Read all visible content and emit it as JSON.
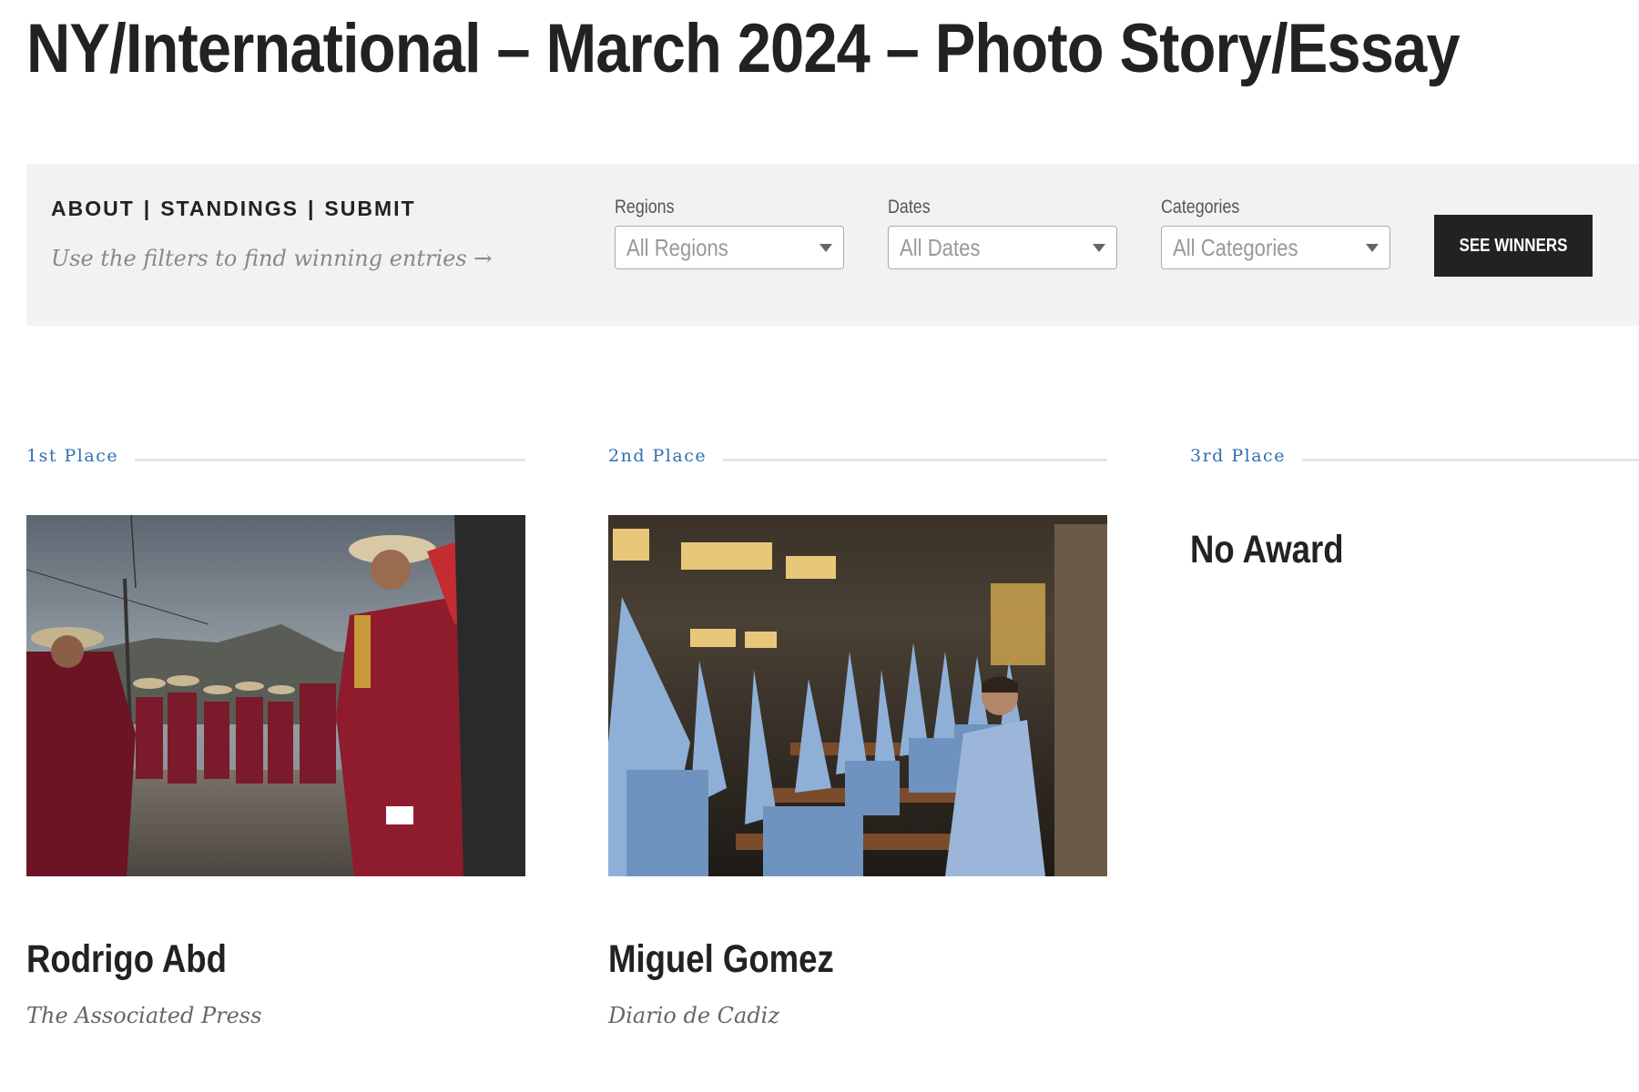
{
  "page": {
    "title": "NY/International – March 2024 – Photo Story/Essay"
  },
  "filters": {
    "nav": {
      "about": "ABOUT",
      "standings": "STANDINGS",
      "submit": "SUBMIT",
      "separator": "|"
    },
    "hint": "Use the filters to find winning entries →",
    "regions": {
      "label": "Regions",
      "value": "All Regions"
    },
    "dates": {
      "label": "Dates",
      "value": "All Dates"
    },
    "categories": {
      "label": "Categories",
      "value": "All Categories"
    },
    "submit_label": "SEE WINNERS"
  },
  "places": [
    {
      "label": "1st Place",
      "name": "Rodrigo Abd",
      "organization": "The Associated Press",
      "photo_subject": "procession of people in red ponchos and hats playing pan flutes"
    },
    {
      "label": "2nd Place",
      "name": "Miguel Gomez",
      "organization": "Diario de Cadiz",
      "photo_subject": "penitents in light blue capirote hoods inside a church"
    },
    {
      "label": "3rd Place",
      "no_award": "No Award"
    }
  ],
  "colors": {
    "accent": "#2f6fb3",
    "filter_bar": "#f2f2f2",
    "button": "#222222"
  }
}
